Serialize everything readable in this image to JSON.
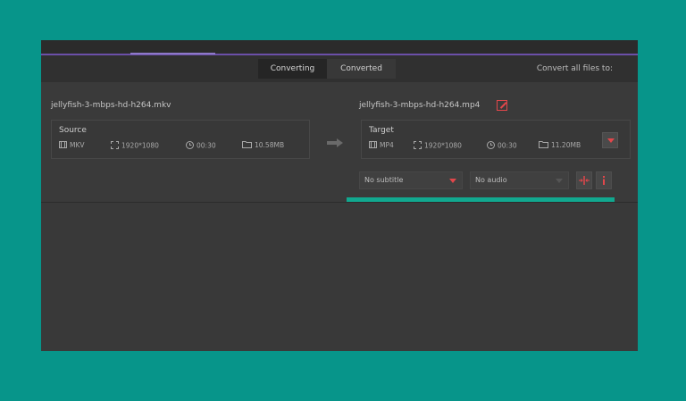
{
  "tabs": {
    "converting": "Converting",
    "converted": "Converted"
  },
  "convert_all_label": "Convert all files to:",
  "source": {
    "filename": "jellyfish-3-mbps-hd-h264.mkv",
    "title": "Source",
    "format": "MKV",
    "resolution": "1920*1080",
    "duration": "00:30",
    "size": "10.58MB"
  },
  "target": {
    "filename": "jellyfish-3-mbps-hd-h264.mp4",
    "title": "Target",
    "format": "MP4",
    "resolution": "1920*1080",
    "duration": "00:30",
    "size": "11.20MB"
  },
  "subtitle_select": "No subtitle",
  "audio_select": "No audio",
  "colors": {
    "accent": "#e2474b",
    "teal": "#11a88f",
    "background": "#07958a"
  }
}
